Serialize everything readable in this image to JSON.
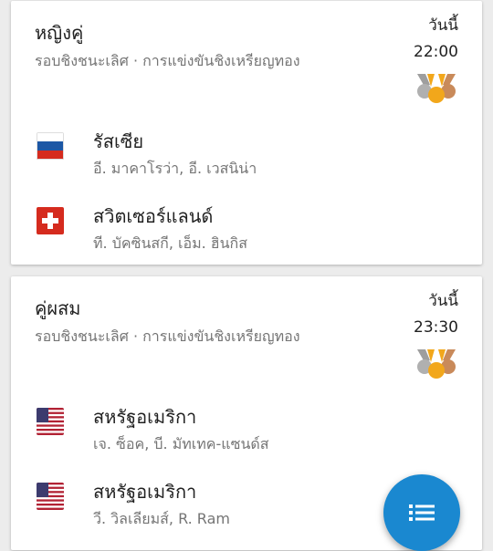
{
  "events": [
    {
      "title": "หญิงคู่",
      "subtitle": "รอบชิงชนะเลิศ · การแข่งขันชิงเหรียญทอง",
      "day": "วันนี้",
      "time": "22:00",
      "teams": [
        {
          "country": "รัสเซีย",
          "players": "อี. มาคาโรว่า, อี. เวสนิน่า",
          "flag": "russia-flag"
        },
        {
          "country": "สวิตเซอร์แลนด์",
          "players": "ที. บัคซินสกี, เอ็ม. ฮินกิส",
          "flag": "switzerland-flag"
        }
      ]
    },
    {
      "title": "คู่ผสม",
      "subtitle": "รอบชิงชนะเลิศ · การแข่งขันชิงเหรียญทอง",
      "day": "วันนี้",
      "time": "23:30",
      "teams": [
        {
          "country": "สหรัฐอเมริกา",
          "players": "เจ. ซ็อค, บี. มัทเทค-แซนด์ส",
          "flag": "usa-flag"
        },
        {
          "country": "สหรัฐอเมริกา",
          "players": "วี. วิลเลียมส์, R. Ram",
          "flag": "usa-flag"
        }
      ]
    }
  ],
  "fab": {
    "icon": "list-icon"
  },
  "colors": {
    "fab": "#1a88d0",
    "gold": "#f2a71b",
    "silver": "#b0b0b0",
    "bronze": "#c98a5a"
  }
}
